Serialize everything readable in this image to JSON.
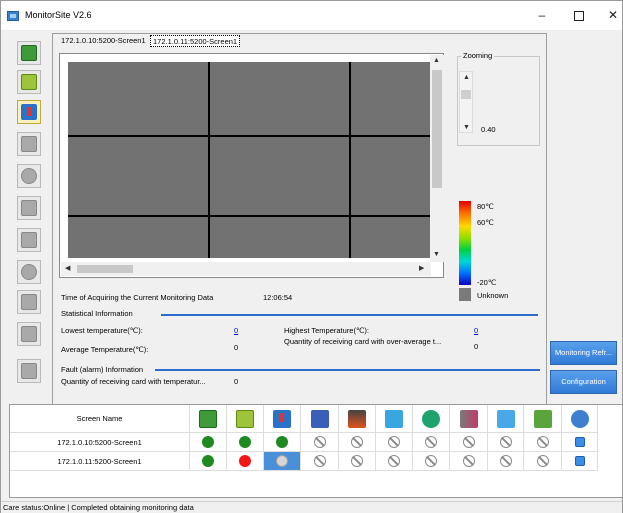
{
  "window": {
    "title": "MonitorSite V2.6",
    "controls": {
      "minimize": "–",
      "maximize": "",
      "close": "✕"
    }
  },
  "toolbar": {
    "items": [
      {
        "name": "computer",
        "icon": "pc-icon"
      },
      {
        "name": "receiving-card",
        "icon": "card-icon"
      },
      {
        "name": "temperature",
        "icon": "thermometer-icon",
        "active": true
      },
      {
        "name": "humidity",
        "icon": "humidity-icon"
      },
      {
        "name": "smoke",
        "icon": "smoke-icon"
      },
      {
        "name": "fire",
        "icon": "fire-icon"
      },
      {
        "name": "fan",
        "icon": "fan-icon"
      },
      {
        "name": "voltage",
        "icon": "voltage-icon"
      },
      {
        "name": "magnet",
        "icon": "magnet-icon"
      },
      {
        "name": "door",
        "icon": "door-icon"
      },
      {
        "name": "module",
        "icon": "module-icon"
      }
    ]
  },
  "tabs": [
    "172.1.0.10:5200-Screen1",
    "172.1.0.11:5200-Screen1"
  ],
  "zoom": {
    "label": "Zooming",
    "value": "0.40"
  },
  "legend": {
    "max": "80℃",
    "high": "60℃",
    "min": "-20℃",
    "unknown": "Unknown"
  },
  "info": {
    "time_label": "Time of Acquiring the Current Monitoring Data",
    "time_value": "12:06:54",
    "stat_title": "Statistical Information",
    "lowest_label": "Lowest temperature(℃):",
    "lowest_value": "0",
    "highest_label": "Highest Temperature(℃):",
    "highest_value": "0",
    "avg_label": "Average Temperature(℃):",
    "avg_value": "0",
    "over_avg_label": "Quantity of receiving card with over-average t...",
    "over_avg_value": "0",
    "fault_title": "Fault (alarm) Information",
    "fault_label": "Quantity of receiving card with temperatur...",
    "fault_value": "0"
  },
  "buttons": {
    "refresh": "Monitoring Refr...",
    "config": "Configuration"
  },
  "table": {
    "header": "Screen Name",
    "header_icons": [
      "pc-icon",
      "card-icon",
      "thermometer-icon",
      "humidity-icon",
      "fire-icon",
      "fan-icon",
      "voltage-icon",
      "magnet-icon",
      "door-icon",
      "module-icon",
      "globe-icon"
    ],
    "rows": [
      {
        "name": "172.1.0.10:5200-Screen1",
        "states": [
          "green",
          "green",
          "green",
          "none",
          "none",
          "none",
          "none",
          "none",
          "none",
          "none",
          "info"
        ]
      },
      {
        "name": "172.1.0.11:5200-Screen1",
        "states": [
          "green",
          "red",
          "grey",
          "none",
          "none",
          "none",
          "none",
          "none",
          "none",
          "none",
          "info"
        ]
      }
    ]
  },
  "status": "Care status:Online  |  Completed obtaining monitoring data",
  "colors": {
    "accent": "#2e6ccb",
    "ok": "#1f8a1f",
    "alarm": "#f21616"
  }
}
